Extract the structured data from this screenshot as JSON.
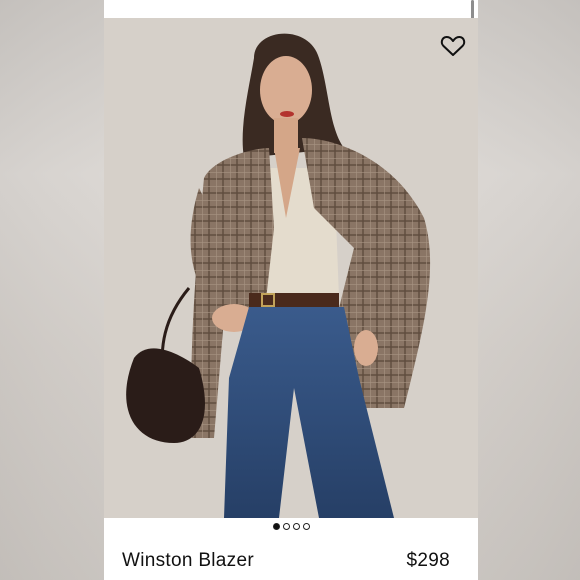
{
  "product": {
    "name": "Winston Blazer",
    "price": "$298"
  },
  "gallery": {
    "image_count": 4,
    "active_index": 0
  },
  "icons": {
    "favorite": "heart-outline-icon"
  },
  "colors": {
    "background": "#ffffff",
    "text": "#111111"
  }
}
